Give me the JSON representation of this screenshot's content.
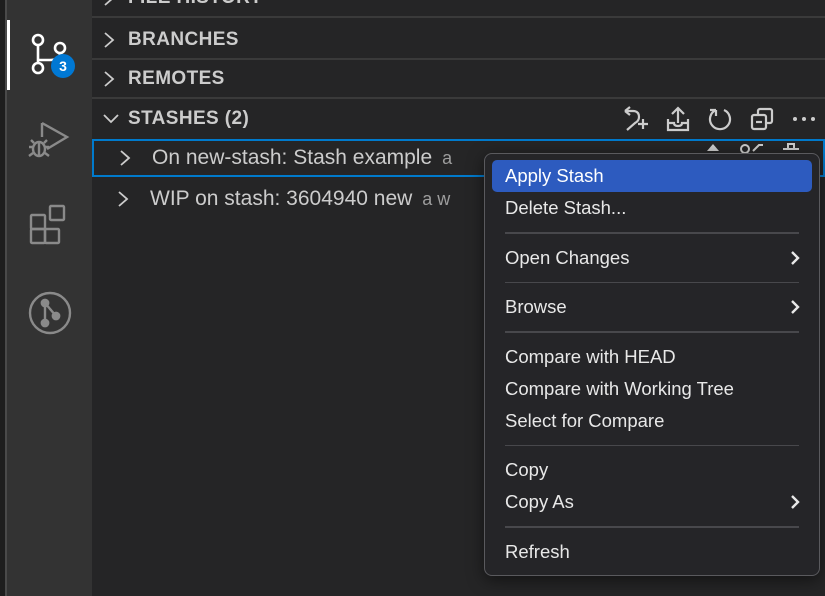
{
  "activity_bar": {
    "items": [
      {
        "name": "source-control",
        "icon": "source-control-icon",
        "active": true,
        "badge": "3"
      },
      {
        "name": "run-and-debug",
        "icon": "debug-icon",
        "active": false
      },
      {
        "name": "extensions",
        "icon": "extensions-icon",
        "active": false
      },
      {
        "name": "gitlens",
        "icon": "gitlens-icon",
        "active": false
      }
    ]
  },
  "sidebar": {
    "sections": [
      {
        "title": "FILE HISTORY",
        "expanded": false
      },
      {
        "title": "BRANCHES",
        "expanded": false
      },
      {
        "title": "REMOTES",
        "expanded": false
      },
      {
        "title": "STASHES (2)",
        "expanded": true
      }
    ],
    "stashes_toolbar": [
      {
        "name": "stash-all",
        "icon": "stash-add-icon"
      },
      {
        "name": "apply-stash",
        "icon": "stash-apply-icon"
      },
      {
        "name": "refresh",
        "icon": "refresh-icon"
      },
      {
        "name": "collapse-all",
        "icon": "collapse-all-icon"
      },
      {
        "name": "more-actions",
        "icon": "ellipsis-icon"
      }
    ],
    "stashes": [
      {
        "label": "On new-stash: Stash example",
        "description": "a",
        "selected": true
      },
      {
        "label": "WIP on stash: 3604940 new",
        "description": "a w",
        "selected": false
      }
    ]
  },
  "context_menu": {
    "groups": [
      [
        {
          "label": "Apply Stash",
          "highlighted": true,
          "submenu": false
        },
        {
          "label": "Delete Stash...",
          "highlighted": false,
          "submenu": false
        }
      ],
      [
        {
          "label": "Open Changes",
          "highlighted": false,
          "submenu": true
        }
      ],
      [
        {
          "label": "Browse",
          "highlighted": false,
          "submenu": true
        }
      ],
      [
        {
          "label": "Compare with HEAD",
          "highlighted": false,
          "submenu": false
        },
        {
          "label": "Compare with Working Tree",
          "highlighted": false,
          "submenu": false
        },
        {
          "label": "Select for Compare",
          "highlighted": false,
          "submenu": false
        }
      ],
      [
        {
          "label": "Copy",
          "highlighted": false,
          "submenu": false
        },
        {
          "label": "Copy As",
          "highlighted": false,
          "submenu": true
        }
      ],
      [
        {
          "label": "Refresh",
          "highlighted": false,
          "submenu": false
        }
      ]
    ]
  },
  "colors": {
    "accent": "#007acc",
    "badge": "#0078d4",
    "menu_highlight": "#2d5bbf",
    "sidebar_bg": "#252526",
    "activity_bar_bg": "#333333"
  }
}
